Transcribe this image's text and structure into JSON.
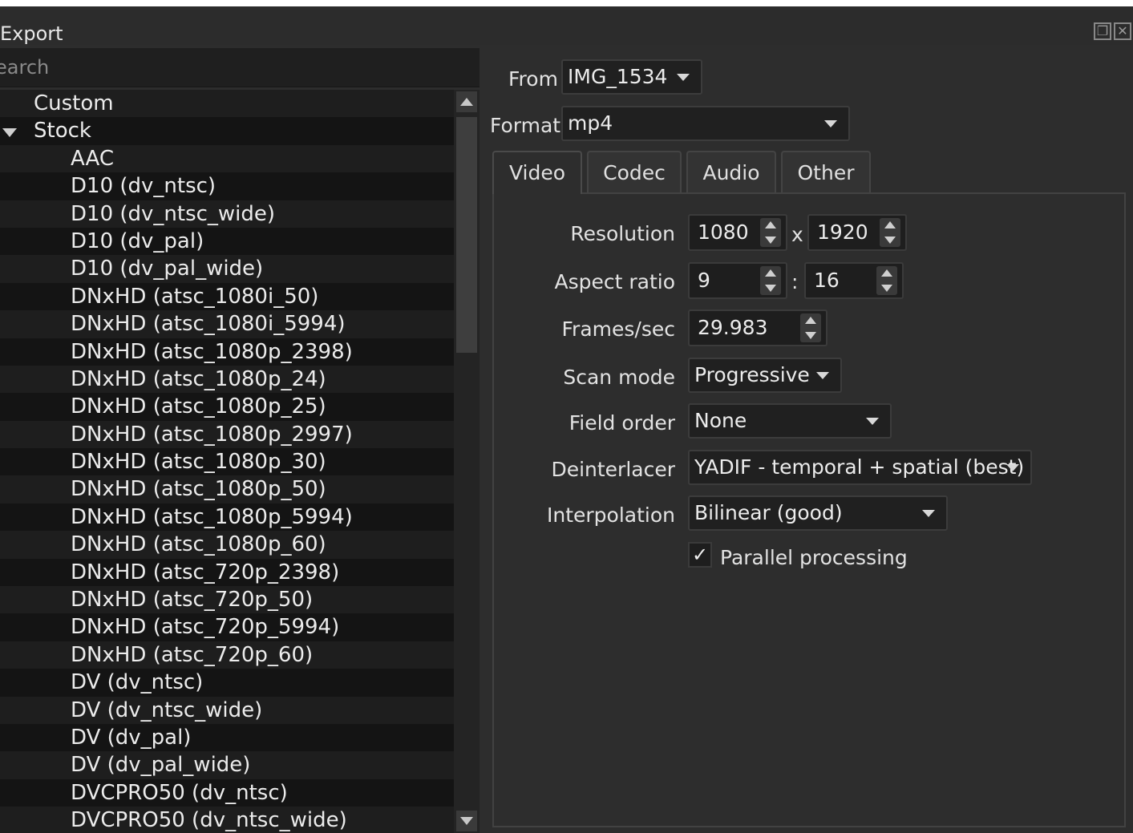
{
  "window": {
    "title": "Export",
    "restore_icon": "restore-icon",
    "close_icon": "close-icon"
  },
  "search": {
    "placeholder": "earch"
  },
  "presets": {
    "groups": [
      {
        "label": "Custom",
        "expanded": false
      },
      {
        "label": "Stock",
        "expanded": true
      }
    ],
    "stock_items": [
      "AAC",
      "D10 (dv_ntsc)",
      "D10 (dv_ntsc_wide)",
      "D10 (dv_pal)",
      "D10 (dv_pal_wide)",
      "DNxHD (atsc_1080i_50)",
      "DNxHD (atsc_1080i_5994)",
      "DNxHD (atsc_1080p_2398)",
      "DNxHD (atsc_1080p_24)",
      "DNxHD (atsc_1080p_25)",
      "DNxHD (atsc_1080p_2997)",
      "DNxHD (atsc_1080p_30)",
      "DNxHD (atsc_1080p_50)",
      "DNxHD (atsc_1080p_5994)",
      "DNxHD (atsc_1080p_60)",
      "DNxHD (atsc_720p_2398)",
      "DNxHD (atsc_720p_50)",
      "DNxHD (atsc_720p_5994)",
      "DNxHD (atsc_720p_60)",
      "DV (dv_ntsc)",
      "DV (dv_ntsc_wide)",
      "DV (dv_pal)",
      "DV (dv_pal_wide)",
      "DVCPRO50 (dv_ntsc)",
      "DVCPRO50 (dv_ntsc_wide)"
    ]
  },
  "from": {
    "label": "From",
    "value": "IMG_1534"
  },
  "format": {
    "label": "Format",
    "value": "mp4"
  },
  "tabs": [
    "Video",
    "Codec",
    "Audio",
    "Other"
  ],
  "active_tab": "Video",
  "video": {
    "resolution": {
      "label": "Resolution",
      "width": "1080",
      "separator": "x",
      "height": "1920"
    },
    "aspect_ratio": {
      "label": "Aspect ratio",
      "num": "9",
      "separator": ":",
      "den": "16"
    },
    "fps": {
      "label": "Frames/sec",
      "value": "29.983"
    },
    "scan_mode": {
      "label": "Scan mode",
      "value": "Progressive"
    },
    "field_order": {
      "label": "Field order",
      "value": "None"
    },
    "deinterlacer": {
      "label": "Deinterlacer",
      "value": "YADIF - temporal + spatial (best)"
    },
    "interpolation": {
      "label": "Interpolation",
      "value": "Bilinear (good)"
    },
    "parallel": {
      "label": "Parallel processing",
      "checked": true,
      "mark": "✓"
    }
  },
  "colors": {
    "background": "#2d2d2d",
    "list_bg": "#1a1a1a",
    "text": "#e6e6e6"
  }
}
